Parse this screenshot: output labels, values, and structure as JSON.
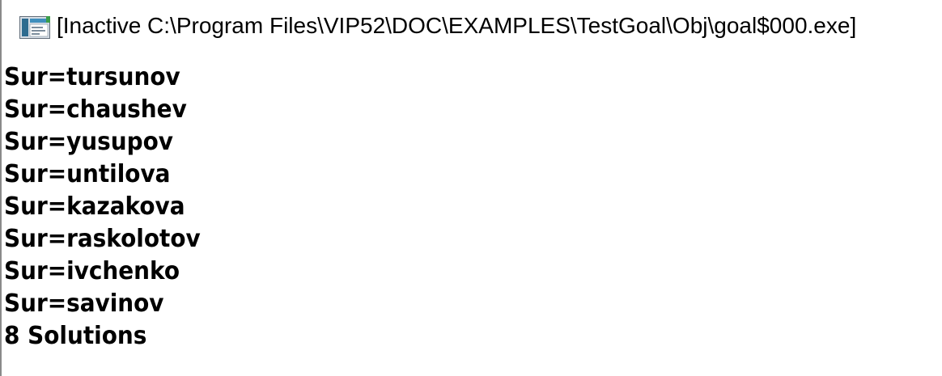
{
  "window": {
    "title": "[Inactive C:\\Program Files\\VIP52\\DOC\\EXAMPLES\\TestGoal\\Obj\\goal$000.exe]",
    "icon": "console-window-icon"
  },
  "output": {
    "lines": [
      "Sur=tursunov",
      "Sur=chaushev",
      "Sur=yusupov",
      "Sur=untilova",
      "Sur=kazakova",
      "Sur=raskolotov",
      "Sur=ivchenko",
      "Sur=savinov",
      "8 Solutions"
    ]
  }
}
